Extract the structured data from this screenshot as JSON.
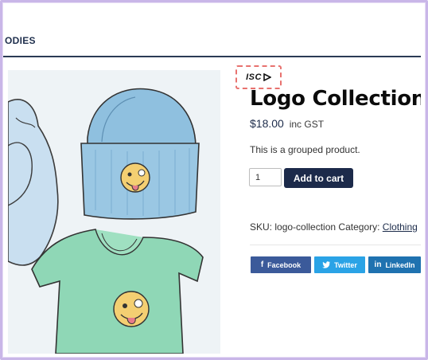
{
  "nav": {
    "item": "ODIES"
  },
  "badge": {
    "text": "ISC"
  },
  "product": {
    "title": "Logo Collection",
    "price": "$18.00",
    "tax": "inc GST",
    "description": "This is a grouped product.",
    "quantity": "1",
    "add_to_cart": "Add to cart",
    "sku_label": "SKU:",
    "sku_value": "logo-collection",
    "category_label": "Category:",
    "category_value": "Clothing"
  },
  "share": {
    "facebook": "Facebook",
    "twitter": "Twitter",
    "linkedin": "LinkedIn"
  },
  "colors": {
    "navy": "#1c2a4a",
    "facebook": "#3b5a9a",
    "twitter": "#2aa3e6",
    "linkedin": "#1f72b0",
    "badge_border": "#e8726f",
    "frame": "#c9b6e8"
  }
}
